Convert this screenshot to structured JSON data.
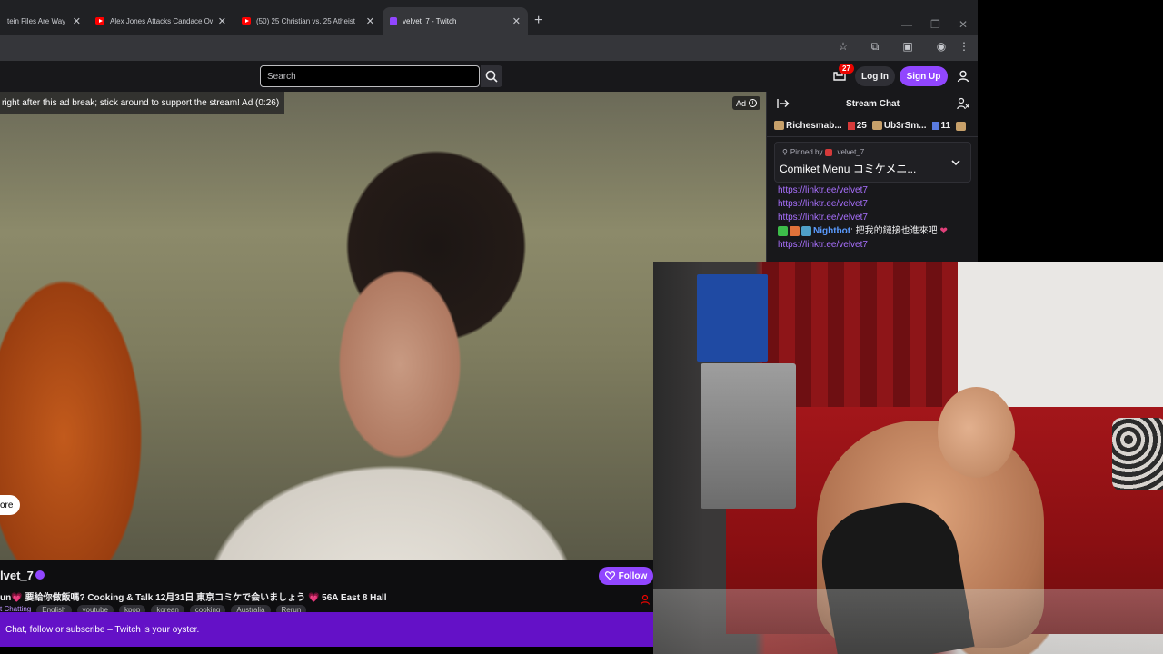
{
  "browser": {
    "tabs": [
      {
        "title": "tein Files Are Way",
        "icon": "page-icon",
        "active": false
      },
      {
        "title": "Alex Jones Attacks Candace Ow",
        "icon": "youtube-icon",
        "active": false
      },
      {
        "title": "(50) 25 Christian vs. 25 Atheist",
        "icon": "youtube-icon",
        "active": false
      },
      {
        "title": "velvet_7 - Twitch",
        "icon": "twitch-icon",
        "active": true
      }
    ]
  },
  "topnav": {
    "search_placeholder": "Search",
    "notifications_count": "27",
    "login_label": "Log In",
    "signup_label": "Sign Up"
  },
  "player": {
    "ad_message": "right after this ad break; stick around to support the stream! Ad (0:26)",
    "ad_tag": "Ad",
    "more_label": "ore"
  },
  "stream": {
    "channel_name": "lvet_7",
    "title": "un💗 要給你做飯嗎? Cooking & Talk 12月31日 東京コミケで会いましょう 💗 56A East 8 Hall",
    "follow_label": "Follow",
    "category": "t Chatting",
    "tags": [
      "English",
      "youtube",
      "kpop",
      "korean",
      "cooking",
      "Australia",
      "Rerun"
    ]
  },
  "promo": {
    "text": "Chat, follow or subscribe – Twitch is your oyster."
  },
  "chat": {
    "header": "Stream Chat",
    "leaderboard": [
      {
        "name": "Richesmab...",
        "count": "25"
      },
      {
        "name": "Ub3rSm...",
        "count": "11"
      }
    ],
    "pinned_by_label": "Pinned by",
    "pinned_by_user": "velvet_7",
    "pinned_message": "Comiket Menu コミケメニ...",
    "links": [
      "https://linktr.ee/velvet7",
      "https://linktr.ee/velvet7",
      "https://linktr.ee/velvet7"
    ],
    "bot_name": "Nightbot",
    "bot_message": ": 把我的鏈接也進來吧",
    "bot_link": "https://linktr.ee/velvet7"
  },
  "colors": {
    "twitch_purple": "#9146ff",
    "promo_purple": "#6411c7",
    "link_purple": "#a970ff"
  }
}
